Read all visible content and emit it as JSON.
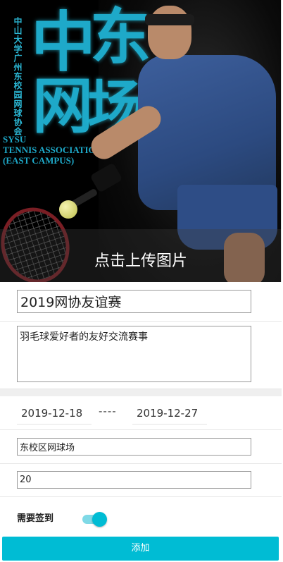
{
  "banner": {
    "vertical_text": "中山大学广州东校园网球协会",
    "big_chars": [
      "中",
      "东",
      "网",
      "场"
    ],
    "english_lines": [
      "SYSU",
      "TENNIS ASSOCIATION",
      "(EAST CAMPUS)"
    ],
    "upload_label": "点击上传图片"
  },
  "form": {
    "title_value": "2019网协友谊赛",
    "description_value": "羽毛球爱好者的友好交流赛事",
    "start_date": "2019-12-18",
    "date_separator": "----",
    "end_date": "2019-12-27",
    "location_value": "东校区网球场",
    "count_value": "20",
    "checkin_label": "需要签到",
    "checkin_enabled": true,
    "submit_label": "添加"
  },
  "colors": {
    "accent": "#00bcd4",
    "toggle_track": "#7fd9e6",
    "banner_text": "#1ea9c9"
  }
}
